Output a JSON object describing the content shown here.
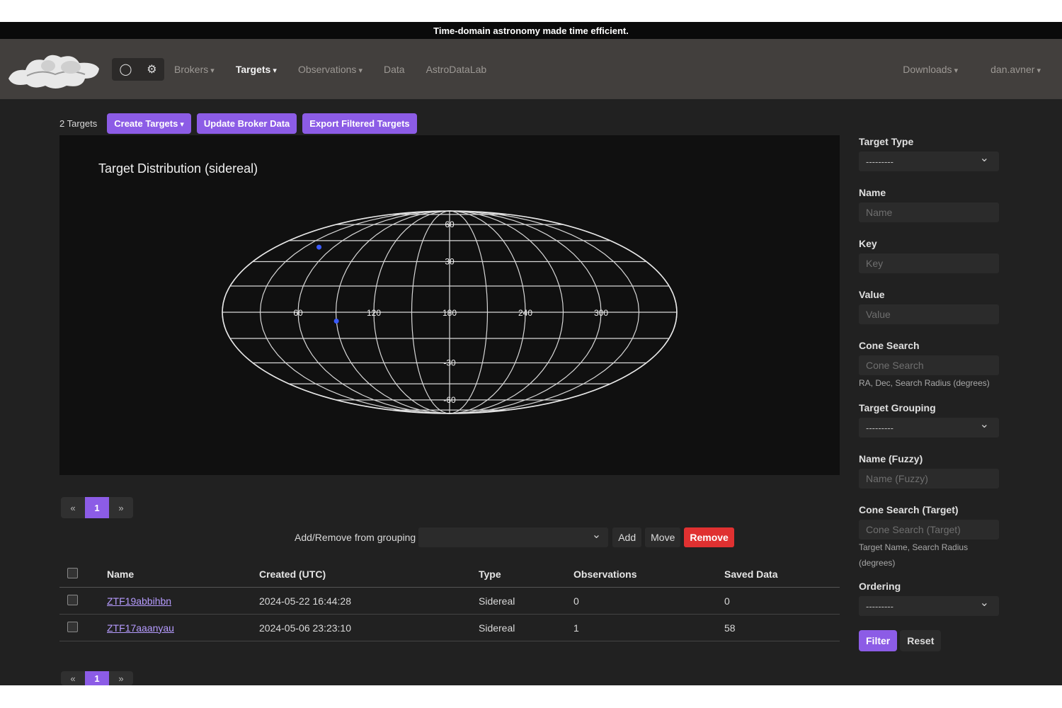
{
  "banner": "Time-domain astronomy made time efficient.",
  "nav": {
    "brokers": "Brokers",
    "targets": "Targets",
    "observations": "Observations",
    "data": "Data",
    "astrodatalab": "AstroDataLab",
    "downloads": "Downloads",
    "user": "dan.avner"
  },
  "toolbar": {
    "count": "2 Targets",
    "create": "Create Targets",
    "update": "Update Broker Data",
    "export": "Export Filtered Targets"
  },
  "plot": {
    "title": "Target Distribution (sidereal)",
    "ra_ticks": [
      "60",
      "120",
      "180",
      "240",
      "300"
    ],
    "dec_ticks": [
      "60",
      "30",
      "-30",
      "-60"
    ],
    "points": [
      {
        "ra": 45,
        "dec": 40
      },
      {
        "ra": 90,
        "dec": -5
      }
    ]
  },
  "pager_top": {
    "prev": "«",
    "current": "1",
    "next": "»"
  },
  "grouping": {
    "label": "Add/Remove from grouping",
    "add": "Add",
    "move": "Move",
    "remove": "Remove"
  },
  "table": {
    "headers": [
      "Name",
      "Created (UTC)",
      "Type",
      "Observations",
      "Saved Data"
    ],
    "rows": [
      {
        "name": "ZTF19abbihbn",
        "created": "2024-05-22 16:44:28",
        "type": "Sidereal",
        "obs": "0",
        "saved": "0"
      },
      {
        "name": "ZTF17aaanyau",
        "created": "2024-05-06 23:23:10",
        "type": "Sidereal",
        "obs": "1",
        "saved": "58"
      }
    ]
  },
  "pager_bottom": {
    "prev": "«",
    "current": "1",
    "next": "»"
  },
  "filters": {
    "target_type": {
      "label": "Target Type",
      "value": "---------"
    },
    "name": {
      "label": "Name",
      "placeholder": "Name"
    },
    "key": {
      "label": "Key",
      "placeholder": "Key"
    },
    "value": {
      "label": "Value",
      "placeholder": "Value"
    },
    "cone": {
      "label": "Cone Search",
      "placeholder": "Cone Search",
      "help": "RA, Dec, Search Radius (degrees)"
    },
    "grouping": {
      "label": "Target Grouping",
      "value": "---------"
    },
    "fuzzy": {
      "label": "Name (Fuzzy)",
      "placeholder": "Name (Fuzzy)"
    },
    "cone_target": {
      "label": "Cone Search (Target)",
      "placeholder": "Cone Search (Target)",
      "help": "Target Name, Search Radius (degrees)"
    },
    "ordering": {
      "label": "Ordering",
      "value": "---------"
    },
    "filter_btn": "Filter",
    "reset_btn": "Reset"
  }
}
